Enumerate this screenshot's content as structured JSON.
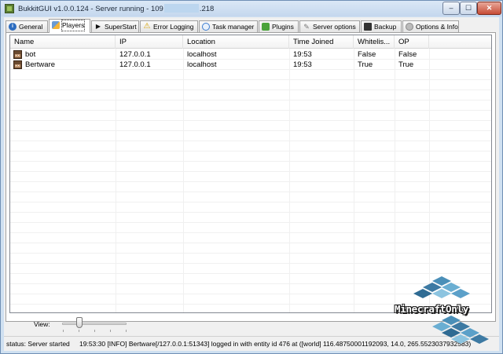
{
  "window": {
    "title_prefix": "BukkitGUI v1.0.0.124 - Server running - 109",
    "title_suffix": ".218",
    "controls": {
      "minimize": "–",
      "maximize": "☐",
      "close": "✕"
    }
  },
  "tabs": [
    {
      "label": "General",
      "icon": "info-icon",
      "active": false
    },
    {
      "label": "Players",
      "icon": "players-icon",
      "active": true
    },
    {
      "label": "SuperStart",
      "icon": "play-icon",
      "active": false
    },
    {
      "label": "Error Logging",
      "icon": "warning-icon",
      "active": false
    },
    {
      "label": "Task manager",
      "icon": "task-icon",
      "active": false
    },
    {
      "label": "Plugins",
      "icon": "plugin-icon",
      "active": false
    },
    {
      "label": "Server options",
      "icon": "wrench-icon",
      "active": false
    },
    {
      "label": "Backup",
      "icon": "backup-icon",
      "active": false
    },
    {
      "label": "Options & Info",
      "icon": "gear-icon",
      "active": false
    }
  ],
  "players_table": {
    "columns": [
      "Name",
      "IP",
      "Location",
      "Time Joined",
      "Whitelis...",
      "OP"
    ],
    "rows": [
      {
        "name": "bot",
        "ip": "127.0.0.1",
        "location": "localhost",
        "time_joined": "19:53",
        "whitelisted": "False",
        "op": "False"
      },
      {
        "name": "Bertware",
        "ip": "127.0.0.1",
        "location": "localhost",
        "time_joined": "19:53",
        "whitelisted": "True",
        "op": "True"
      }
    ]
  },
  "view": {
    "label": "View:"
  },
  "status": {
    "text": "status: Server started",
    "log": "19:53:30 [INFO] Bertware[/127.0.0.1:51343] logged in with entity id 476 at ([world] 116.48750001192093, 14.0, 265.5523037932583)"
  },
  "watermark": {
    "text": "MinecraftOnly"
  },
  "colors": {
    "title_bar": "#c4d7ee",
    "close_button": "#c74c36",
    "tab_border": "#a0a0a0"
  }
}
